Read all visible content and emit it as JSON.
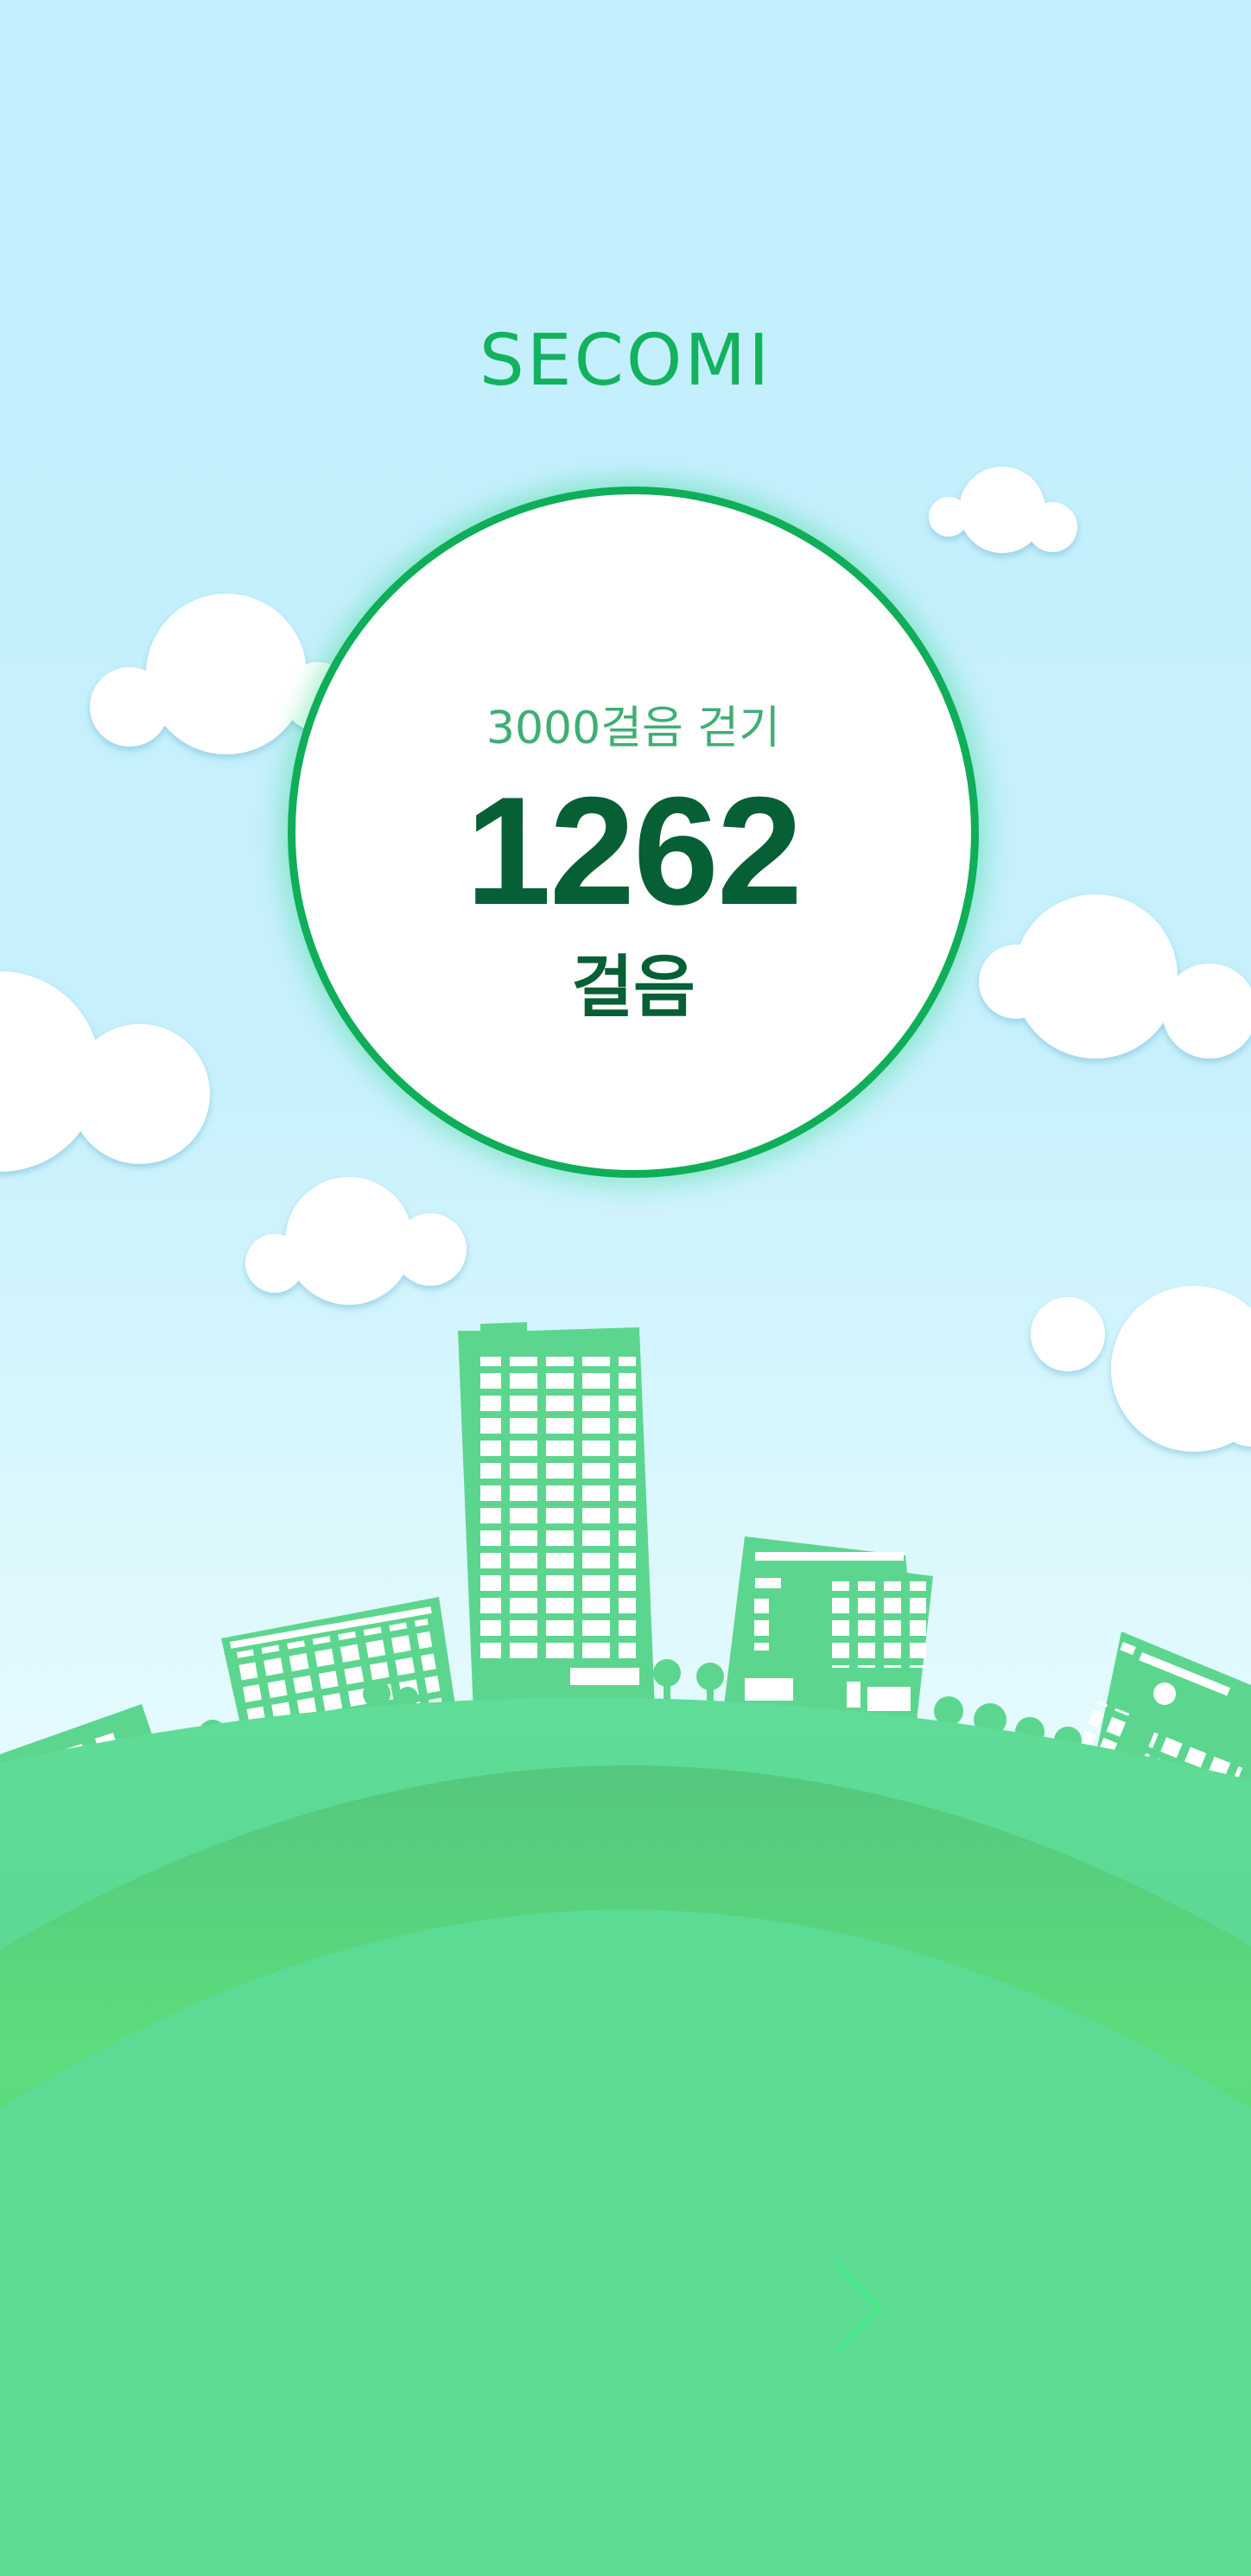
{
  "header": {
    "app_title": "SECOMI"
  },
  "step_tracker": {
    "goal_label": "3000걸음 걷기",
    "step_count": "1262",
    "unit_label": "걸음"
  },
  "navigation": {
    "next_icon": "chevron-right-icon"
  },
  "colors": {
    "accent": "#0fae58",
    "title_green": "#12b25e",
    "count_green": "#075f35",
    "sky_top": "#c2effc",
    "ground": "#5cdb95"
  }
}
